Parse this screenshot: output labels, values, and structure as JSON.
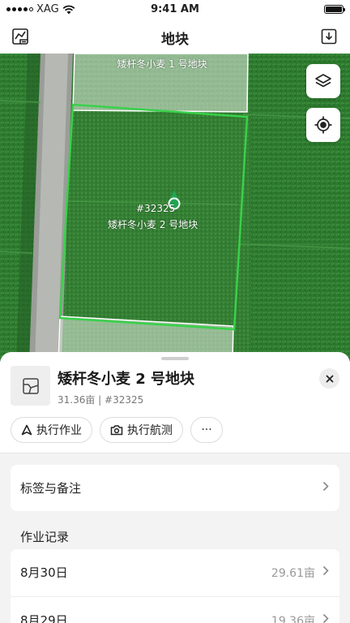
{
  "status_bar": {
    "carrier": "XAG",
    "time": "9:41 AM"
  },
  "nav": {
    "title": "地块",
    "left_icon": "field-list-icon",
    "right_icon": "download-icon"
  },
  "map": {
    "top_field_label": "矮杆冬小麦 1 号地块",
    "selected_field_id": "#32325",
    "selected_field_label": "矮杆冬小麦 2 号地块",
    "controls": [
      "layers-icon",
      "locate-icon"
    ]
  },
  "sheet": {
    "title": "矮杆冬小麦 2 号地块",
    "meta": "31.36亩 | #32325",
    "actions": [
      {
        "label": "执行作业",
        "icon": "navigate-arrow-icon"
      },
      {
        "label": "执行航测",
        "icon": "camera-icon"
      },
      {
        "label": "···",
        "icon": "more-icon"
      }
    ],
    "tags_label": "标签与备注",
    "records_title": "作业记录",
    "records": [
      {
        "date": "8月30日",
        "area": "29.61亩"
      },
      {
        "date": "8月29日",
        "area": "19.36亩"
      }
    ]
  },
  "colors": {
    "field_green": "#2f7a2f",
    "accent": "#22a552",
    "boundary": "#39d14a"
  }
}
